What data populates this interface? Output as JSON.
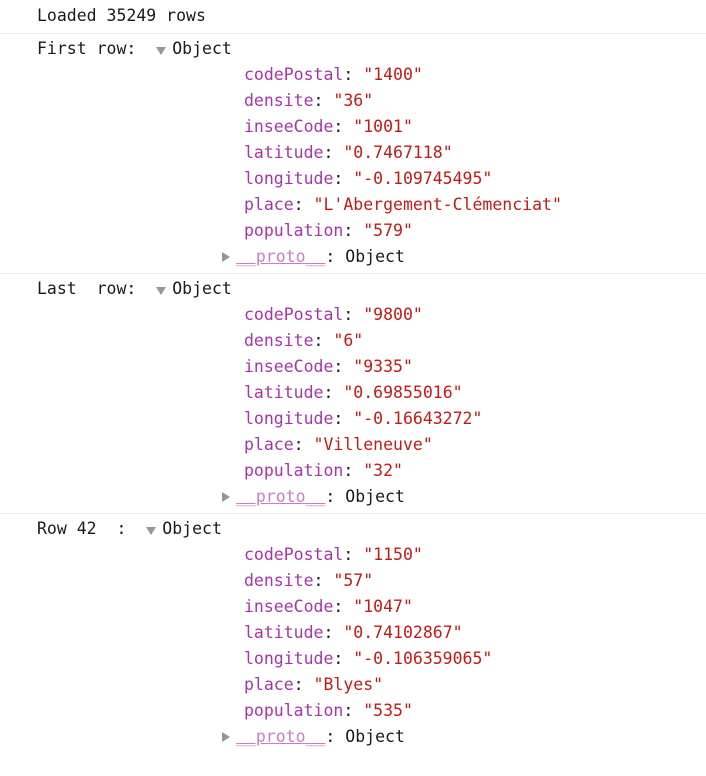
{
  "console": {
    "messages": [
      {
        "kind": "text",
        "name": "loaded-rows-message",
        "text": "Loaded 35249 rows"
      },
      {
        "kind": "object",
        "name": "first-row-object",
        "label": "First row:  ",
        "expander_icon": "triangle-down-icon",
        "type": "Object",
        "properties": [
          {
            "key": "codePostal",
            "colon": ": ",
            "value": "\"1400\""
          },
          {
            "key": "densite",
            "colon": ": ",
            "value": "\"36\""
          },
          {
            "key": "inseeCode",
            "colon": ": ",
            "value": "\"1001\""
          },
          {
            "key": "latitude",
            "colon": ": ",
            "value": "\"0.7467118\""
          },
          {
            "key": "longitude",
            "colon": ": ",
            "value": "\"-0.109745495\""
          },
          {
            "key": "place",
            "colon": ": ",
            "value": "\"L'Abergement-Clémenciat\""
          },
          {
            "key": "population",
            "colon": ": ",
            "value": "\"579\""
          }
        ],
        "proto": {
          "expander_icon": "triangle-right-icon",
          "key": "__proto__",
          "colon": ": ",
          "type": "Object"
        }
      },
      {
        "kind": "object",
        "name": "last-row-object",
        "label": "Last  row:  ",
        "expander_icon": "triangle-down-icon",
        "type": "Object",
        "properties": [
          {
            "key": "codePostal",
            "colon": ": ",
            "value": "\"9800\""
          },
          {
            "key": "densite",
            "colon": ": ",
            "value": "\"6\""
          },
          {
            "key": "inseeCode",
            "colon": ": ",
            "value": "\"9335\""
          },
          {
            "key": "latitude",
            "colon": ": ",
            "value": "\"0.69855016\""
          },
          {
            "key": "longitude",
            "colon": ": ",
            "value": "\"-0.16643272\""
          },
          {
            "key": "place",
            "colon": ": ",
            "value": "\"Villeneuve\""
          },
          {
            "key": "population",
            "colon": ": ",
            "value": "\"32\""
          }
        ],
        "proto": {
          "expander_icon": "triangle-right-icon",
          "key": "__proto__",
          "colon": ": ",
          "type": "Object"
        }
      },
      {
        "kind": "object",
        "name": "row-42-object",
        "label": "Row 42  :  ",
        "expander_icon": "triangle-down-icon",
        "type": "Object",
        "properties": [
          {
            "key": "codePostal",
            "colon": ": ",
            "value": "\"1150\""
          },
          {
            "key": "densite",
            "colon": ": ",
            "value": "\"57\""
          },
          {
            "key": "inseeCode",
            "colon": ": ",
            "value": "\"1047\""
          },
          {
            "key": "latitude",
            "colon": ": ",
            "value": "\"0.74102867\""
          },
          {
            "key": "longitude",
            "colon": ": ",
            "value": "\"-0.106359065\""
          },
          {
            "key": "place",
            "colon": ": ",
            "value": "\"Blyes\""
          },
          {
            "key": "population",
            "colon": ": ",
            "value": "\"535\""
          }
        ],
        "proto": {
          "expander_icon": "triangle-right-icon",
          "key": "__proto__",
          "colon": ": ",
          "type": "Object"
        }
      }
    ]
  },
  "colors": {
    "background": "#ffffff",
    "text": "#1a1a1a",
    "property_key": "#a834a8",
    "string_value": "#c41a16",
    "proto_key": "#c77ec7",
    "separator": "#ececec",
    "triangle": "#969696"
  }
}
